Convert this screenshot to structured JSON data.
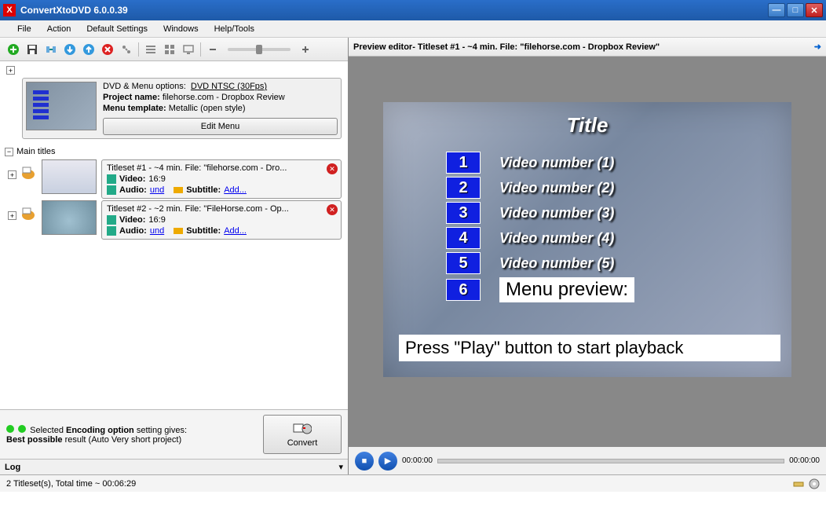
{
  "window": {
    "title": "ConvertXtoDVD 6.0.0.39"
  },
  "menu": {
    "file": "File",
    "action": "Action",
    "defaults": "Default Settings",
    "windows": "Windows",
    "help": "Help/Tools"
  },
  "dvd": {
    "options_label": "DVD & Menu options:",
    "options_value": "DVD NTSC (30Fps)",
    "project_label": "Project name:",
    "project_value": "filehorse.com - Dropbox Review",
    "template_label": "Menu template:",
    "template_value": "Metallic (open style)",
    "edit_menu": "Edit Menu"
  },
  "tree": {
    "main_titles": "Main titles",
    "video_label": "Video:",
    "audio_label": "Audio:",
    "subtitle_label": "Subtitle:",
    "undetermined": "und",
    "add": "Add...",
    "ts1": {
      "title": "Titleset #1 - ~4 min. File: \"filehorse.com - Dro...",
      "video": "16:9"
    },
    "ts2": {
      "title": "Titleset #2 - ~2 min. File: \"FileHorse.com - Op...",
      "video": "16:9"
    }
  },
  "encoding": {
    "line1a": "Selected ",
    "line1b": "Encoding option",
    "line1c": " setting gives:",
    "line2a": "Best possible",
    "line2b": " result (Auto Very short project)",
    "convert": "Convert"
  },
  "log": {
    "label": "Log"
  },
  "preview": {
    "header_a": "Preview editor",
    "header_b": " - Titleset #1 - ~4 min. File: \"filehorse.com - Dropbox Review\"",
    "title": "Title",
    "items": [
      "Video number (1)",
      "Video number (2)",
      "Video number (3)",
      "Video number (4)",
      "Video number (5)"
    ],
    "menu_preview": "Menu preview:",
    "hint": "Press \"Play\" button to start playback"
  },
  "player": {
    "time_current": "00:00:00",
    "time_total": "00:00:00"
  },
  "status": {
    "text": "2 Titleset(s), Total time ~ 00:06:29"
  }
}
